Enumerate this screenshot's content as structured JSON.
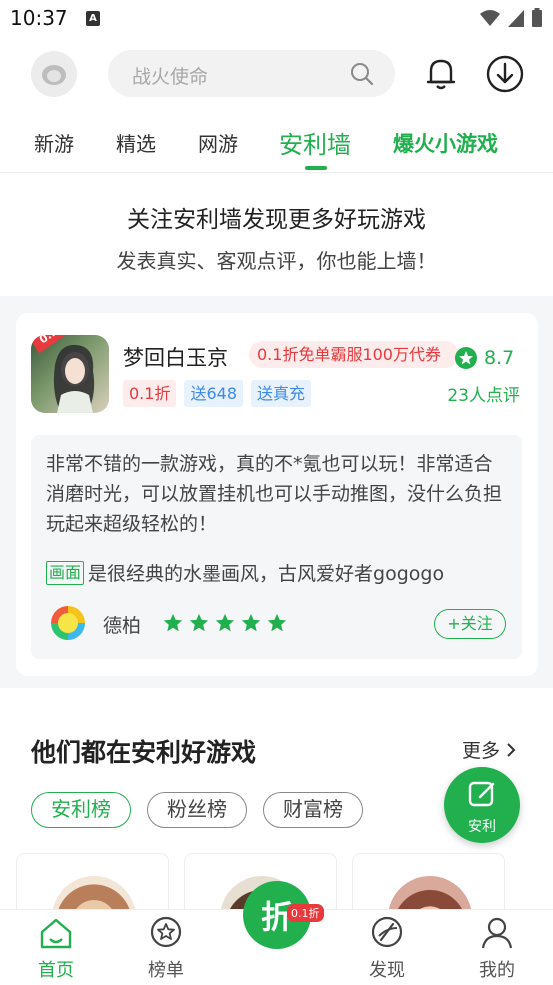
{
  "status_bar": {
    "time": "10:37",
    "indicator": "A"
  },
  "header": {
    "search_placeholder": "战火使命"
  },
  "tabs": [
    {
      "label": "新游"
    },
    {
      "label": "精选"
    },
    {
      "label": "网游"
    },
    {
      "label": "安利墙"
    },
    {
      "label": "爆火小游戏"
    }
  ],
  "intro": {
    "title": "关注安利墙发现更多好玩游戏",
    "subtitle": "发表真实、客观点评，你也能上墙！"
  },
  "review_card": {
    "game_name": "梦回白玉京",
    "icon_badge": "0.1折",
    "promo": "0.1折免单霸服100万代券",
    "rating": "8.7",
    "review_count": "23人点评",
    "tags": [
      "0.1折",
      "送648",
      "送真充"
    ],
    "review_text": "非常不错的一款游戏，真的不*氪也可以玩！非常适合消磨时光，可以放置挂机也可以手动推图，没什么负担玩起来超级轻松的！",
    "review_tag_label": "画面",
    "review_tag_text": "是很经典的水墨画风，古风爱好者gogogo",
    "reviewer_name": "德柏",
    "stars": 5,
    "follow_label": "+关注"
  },
  "section": {
    "title": "他们都在安利好游戏",
    "more_label": "更多",
    "chips": [
      "安利榜",
      "粉丝榜",
      "财富榜"
    ]
  },
  "fab": {
    "label": "安利"
  },
  "bottom_nav": {
    "items": [
      {
        "label": "首页",
        "icon": "home-icon"
      },
      {
        "label": "榜单",
        "icon": "star-badge-icon"
      },
      {
        "label": "发现",
        "icon": "compass-icon"
      },
      {
        "label": "我的",
        "icon": "user-icon"
      }
    ],
    "center_label": "折",
    "center_badge": "0.1折"
  },
  "colors": {
    "accent": "#22b04f",
    "red": "#e8393d",
    "blue": "#3d8ae8"
  }
}
